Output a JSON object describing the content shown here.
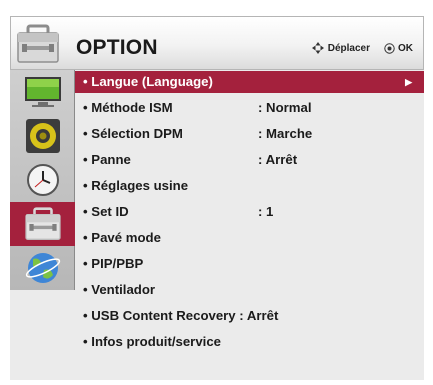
{
  "header": {
    "title": "OPTION",
    "move_label": "Déplacer",
    "ok_label": "OK"
  },
  "sidebar": {
    "items": [
      {
        "icon": "picture-monitor-icon"
      },
      {
        "icon": "speaker-icon"
      },
      {
        "icon": "clock-icon"
      },
      {
        "icon": "toolbox-icon",
        "active": true
      },
      {
        "icon": "globe-icon"
      }
    ]
  },
  "menu": {
    "items": [
      {
        "label": "• Langue (Language)",
        "value": "",
        "selected": true
      },
      {
        "label": "• Méthode ISM",
        "value": ": Normal"
      },
      {
        "label": "• Sélection DPM",
        "value": ": Marche"
      },
      {
        "label": "• Panne",
        "value": ": Arrêt"
      },
      {
        "label": "• Réglages usine",
        "value": ""
      },
      {
        "label": "• Set ID",
        "value": ": 1"
      },
      {
        "label": "• Pavé mode",
        "value": ""
      },
      {
        "label": "• PIP/PBP",
        "value": ""
      },
      {
        "label": "• Ventilador",
        "value": ""
      },
      {
        "label": "• USB Content Recovery : Arrêt",
        "value": ""
      },
      {
        "label": "• Infos produit/service",
        "value": ""
      }
    ]
  },
  "colors": {
    "accent": "#a4213d",
    "panel": "#ebebeb",
    "sidebar": "#c3c3c3"
  }
}
